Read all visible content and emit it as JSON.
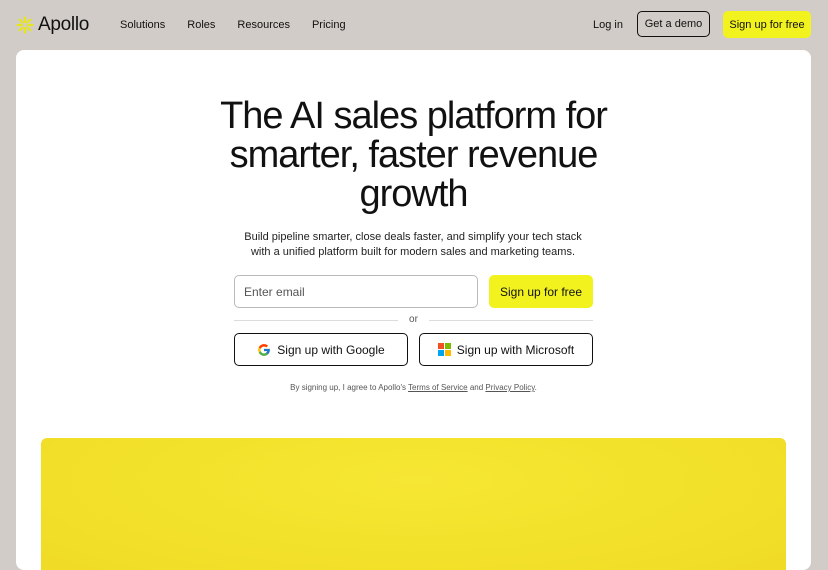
{
  "nav": {
    "brand": "Apollo",
    "links": [
      "Solutions",
      "Roles",
      "Resources",
      "Pricing"
    ],
    "login": "Log in",
    "demo": "Get a demo",
    "signup": "Sign up for free"
  },
  "hero": {
    "title_lines": [
      "The AI sales platform for",
      "smarter, faster revenue",
      "growth"
    ],
    "subtitle_lines": [
      "Build pipeline smarter, close deals faster, and simplify your tech stack",
      "with a unified platform built for modern sales and marketing teams."
    ],
    "email_placeholder": "Enter email",
    "signup": "Sign up for free",
    "or": "or",
    "google": "Sign up with Google",
    "microsoft": "Sign up with Microsoft",
    "terms_prefix": "By signing up, I agree to Apollo's ",
    "terms_link": "Terms of Service",
    "terms_and": " and ",
    "privacy_link": "Privacy Policy",
    "terms_suffix": "."
  },
  "colors": {
    "page_bg": "#d1ccc7",
    "accent": "#f2f21f",
    "panel": "#f2e12a"
  },
  "icons": {
    "brand": "apollo-logo-icon",
    "google": "google-icon",
    "microsoft": "microsoft-icon"
  }
}
